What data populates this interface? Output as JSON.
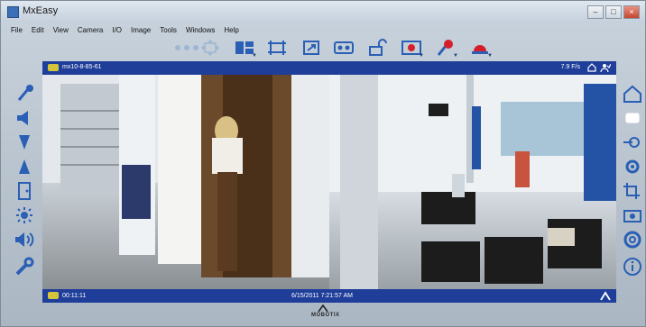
{
  "app": {
    "title": "MxEasy"
  },
  "window_controls": {
    "minimize": "–",
    "maximize": "□",
    "close": "×"
  },
  "menu": [
    "File",
    "Edit",
    "View",
    "Camera",
    "I/O",
    "Image",
    "Tools",
    "Windows",
    "Help"
  ],
  "toolbar_icons": [
    "dots-icon",
    "pan-arrows-icon",
    "layout-split-icon",
    "full-frame-icon",
    "resize-icon",
    "recording-icon",
    "lock-icon",
    "record-button-icon",
    "event-broom-icon",
    "alarm-light-icon"
  ],
  "camera": {
    "name": "mx10-8-85-61",
    "fps": "7.9 F/s",
    "timer": "00:11:11",
    "timestamp": "6/15/2011 7:21:57 AM"
  },
  "left_tools": [
    "microphone-icon",
    "speaker-icon",
    "arrow-down-icon",
    "arrow-up-icon",
    "door-icon",
    "light-bulb-icon",
    "audio-icon",
    "wrench-icon"
  ],
  "right_tools": [
    "home-icon",
    "multi-frame-icon",
    "sensor-icon",
    "gear-icon",
    "crop-icon",
    "camera-icon",
    "ring-icon",
    "info-icon"
  ],
  "brand": {
    "logo_text": "MOBOTIX"
  },
  "colors": {
    "bar": "#1f3e9a",
    "accent": "#1d3f7a",
    "icon": "#2a5fb5",
    "record": "#d3202a"
  }
}
